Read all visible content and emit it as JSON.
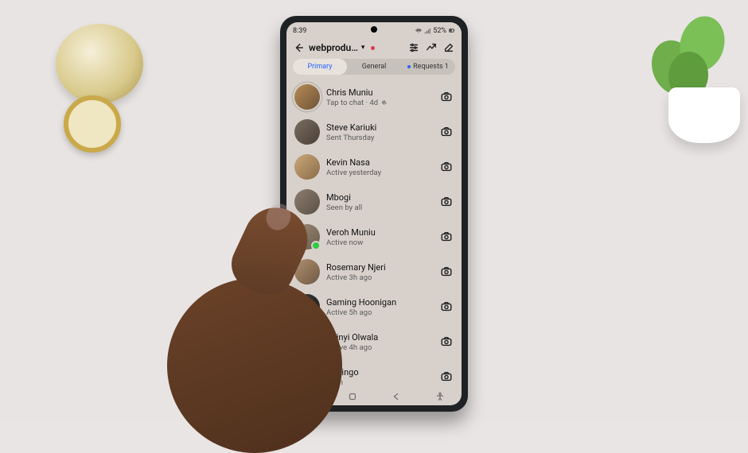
{
  "status": {
    "time": "8:39",
    "battery": "52%"
  },
  "header": {
    "title": "webprodu…"
  },
  "tabs": {
    "primary": "Primary",
    "general": "General",
    "requests": "Requests 1"
  },
  "chats": [
    {
      "name": "Chris Muniu",
      "sub": "Tap to chat · 4d",
      "muted": true,
      "online": false,
      "story": true
    },
    {
      "name": "Steve Kariuki",
      "sub": "Sent Thursday",
      "muted": false,
      "online": false,
      "story": false
    },
    {
      "name": "Kevin Nasa",
      "sub": "Active yesterday",
      "muted": false,
      "online": false,
      "story": false
    },
    {
      "name": "Mbogi",
      "sub": "Seen by all",
      "muted": false,
      "online": false,
      "story": false
    },
    {
      "name": "Veroh Muniu",
      "sub": "Active now",
      "muted": false,
      "online": true,
      "story": false
    },
    {
      "name": "Rosemary Njeri",
      "sub": "Active 3h ago",
      "muted": false,
      "online": false,
      "story": false
    },
    {
      "name": "Gaming Hoonigan",
      "sub": "Active 5h ago",
      "muted": false,
      "online": false,
      "story": false
    },
    {
      "name": "Akinyi Olwala",
      "sub": "Active 4h ago",
      "muted": false,
      "online": false,
      "story": false
    },
    {
      "name": "Muringo",
      "sub": "Seen",
      "muted": false,
      "online": false,
      "story": false
    }
  ]
}
